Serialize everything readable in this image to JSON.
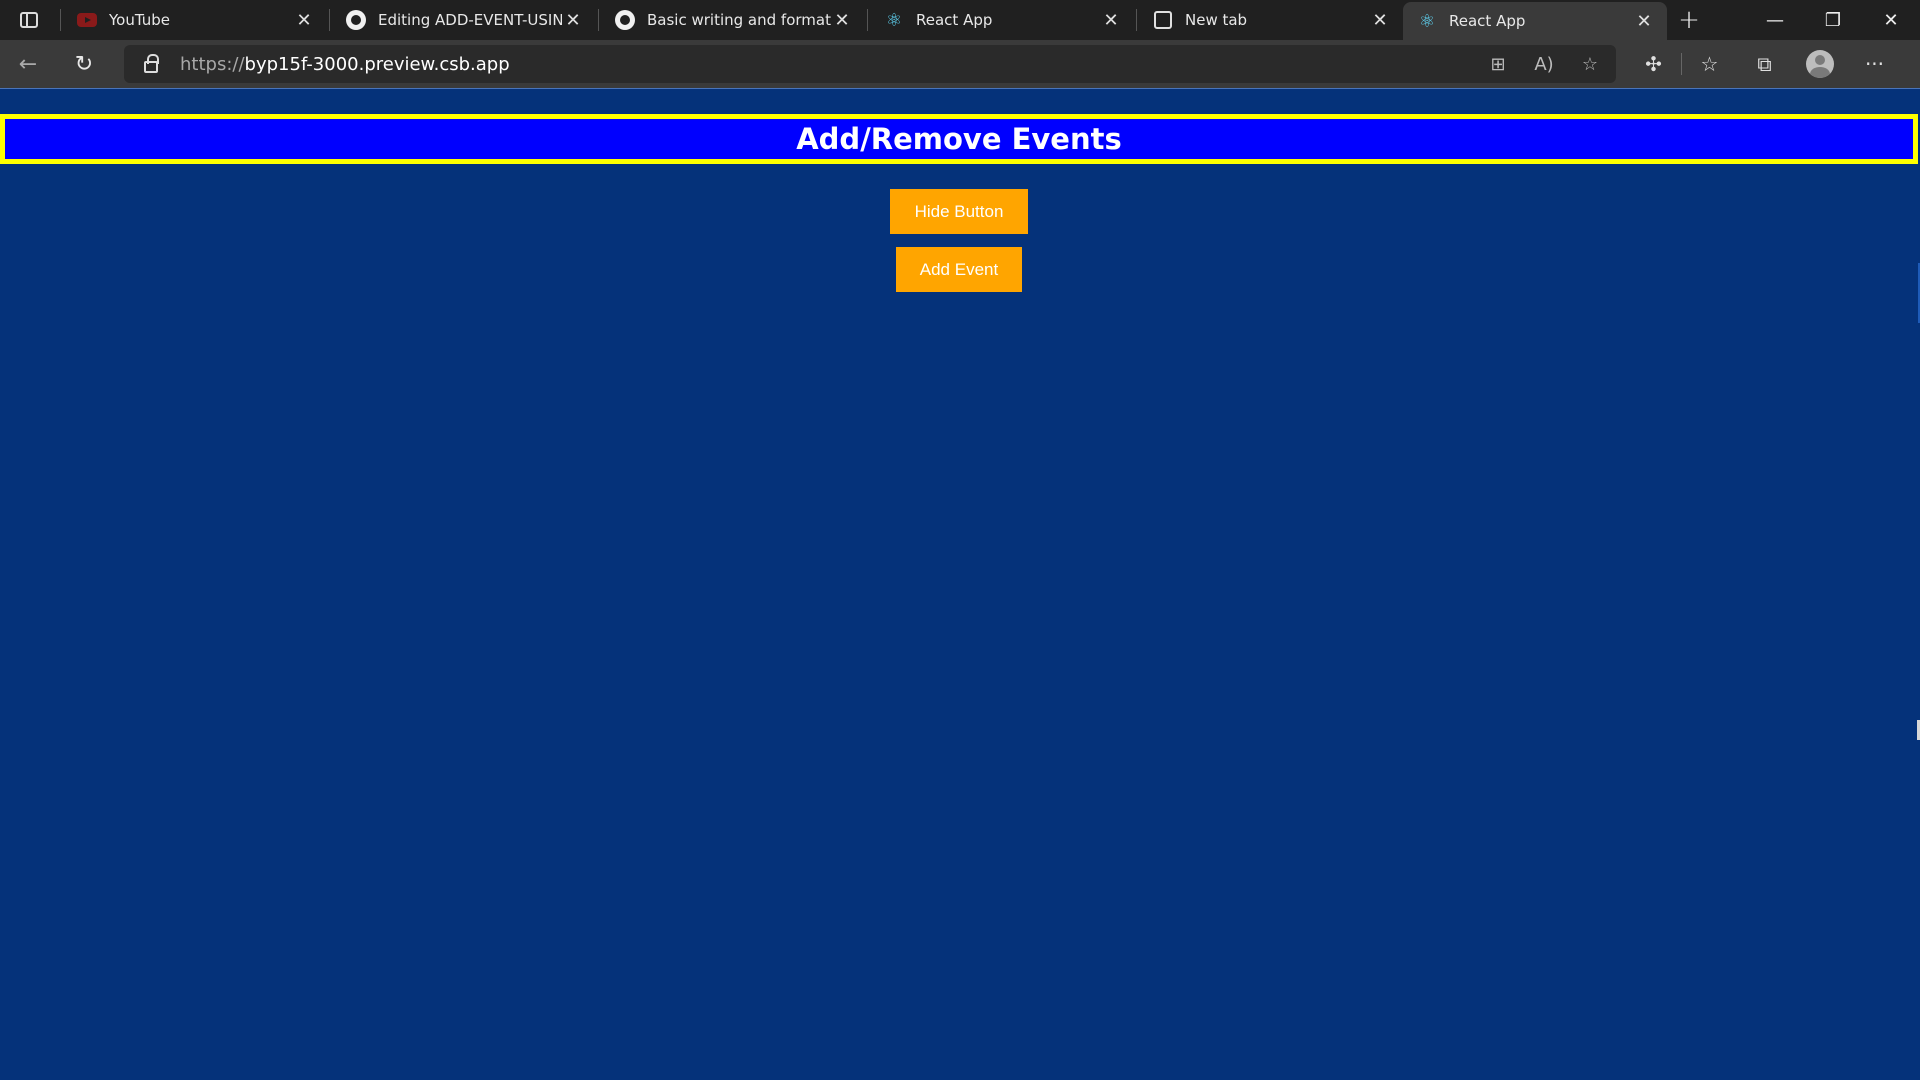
{
  "browser": {
    "tabs": [
      {
        "label": "YouTube",
        "favicon": "youtube-icon",
        "active": false
      },
      {
        "label": "Editing ADD-EVENT-USING-",
        "favicon": "github-icon",
        "active": false
      },
      {
        "label": "Basic writing and formatting",
        "favicon": "github-icon",
        "active": false
      },
      {
        "label": "React App",
        "favicon": "react-icon",
        "active": false
      },
      {
        "label": "New tab",
        "favicon": "newtab-icon",
        "active": false
      },
      {
        "label": "React App",
        "favicon": "react-icon",
        "active": true
      }
    ],
    "url_scheme": "https://",
    "url_host": "byp15f-3000.preview.csb.app"
  },
  "page": {
    "heading": "Add/Remove Events",
    "hide_button_label": "Hide Button",
    "add_event_button_label": "Add Event"
  },
  "colors": {
    "page_background": "#05327a",
    "banner_background": "#0000ff",
    "banner_border": "#ffff00",
    "button_background": "#ffa500"
  }
}
